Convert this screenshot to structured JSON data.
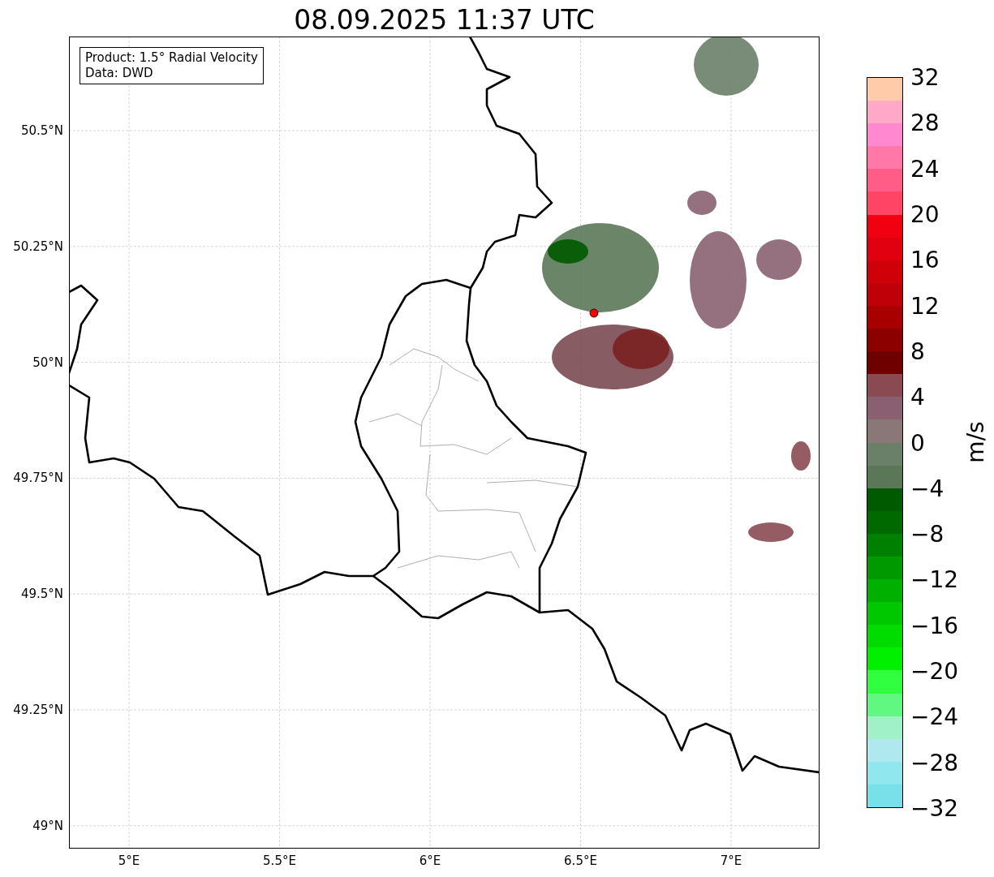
{
  "title": "08.09.2025 11:37 UTC",
  "legend": [
    "Product: 1.5° Radial Velocity",
    "Data: DWD"
  ],
  "y_ticks": [
    "50.5°N",
    "50.25°N",
    "50°N",
    "49.75°N",
    "49.5°N",
    "49.25°N",
    "49°N"
  ],
  "x_ticks": [
    "5°E",
    "5.5°E",
    "6°E",
    "6.5°E",
    "7°E"
  ],
  "colorbar": {
    "label": "m/s",
    "ticks": [
      "32",
      "28",
      "24",
      "20",
      "16",
      "12",
      "8",
      "4",
      "0",
      "−4",
      "−8",
      "−12",
      "−16",
      "−20",
      "−24",
      "−28",
      "−32"
    ],
    "segments": [
      {
        "color": "#ffcba8"
      },
      {
        "color": "#ffa8c8"
      },
      {
        "color": "#ff88d0"
      },
      {
        "color": "#ff78a8"
      },
      {
        "color": "#ff5c88"
      },
      {
        "color": "#ff4466"
      },
      {
        "color": "#f00010"
      },
      {
        "color": "#e00010"
      },
      {
        "color": "#d00008"
      },
      {
        "color": "#c00008"
      },
      {
        "color": "#a80000"
      },
      {
        "color": "#8c0000"
      },
      {
        "color": "#6e0000"
      },
      {
        "color": "#8a4a52"
      },
      {
        "color": "#8a6070"
      },
      {
        "color": "#8a7878"
      },
      {
        "color": "#6a8068"
      },
      {
        "color": "#5a7858"
      },
      {
        "color": "#005a00"
      },
      {
        "color": "#006a00"
      },
      {
        "color": "#008000"
      },
      {
        "color": "#009a00"
      },
      {
        "color": "#00b000"
      },
      {
        "color": "#00c800"
      },
      {
        "color": "#00dc00"
      },
      {
        "color": "#00f000"
      },
      {
        "color": "#30ff40"
      },
      {
        "color": "#60f880"
      },
      {
        "color": "#a0f0c8"
      },
      {
        "color": "#b0e8f0"
      },
      {
        "color": "#90e8ee"
      },
      {
        "color": "#78e0e8"
      }
    ]
  }
}
